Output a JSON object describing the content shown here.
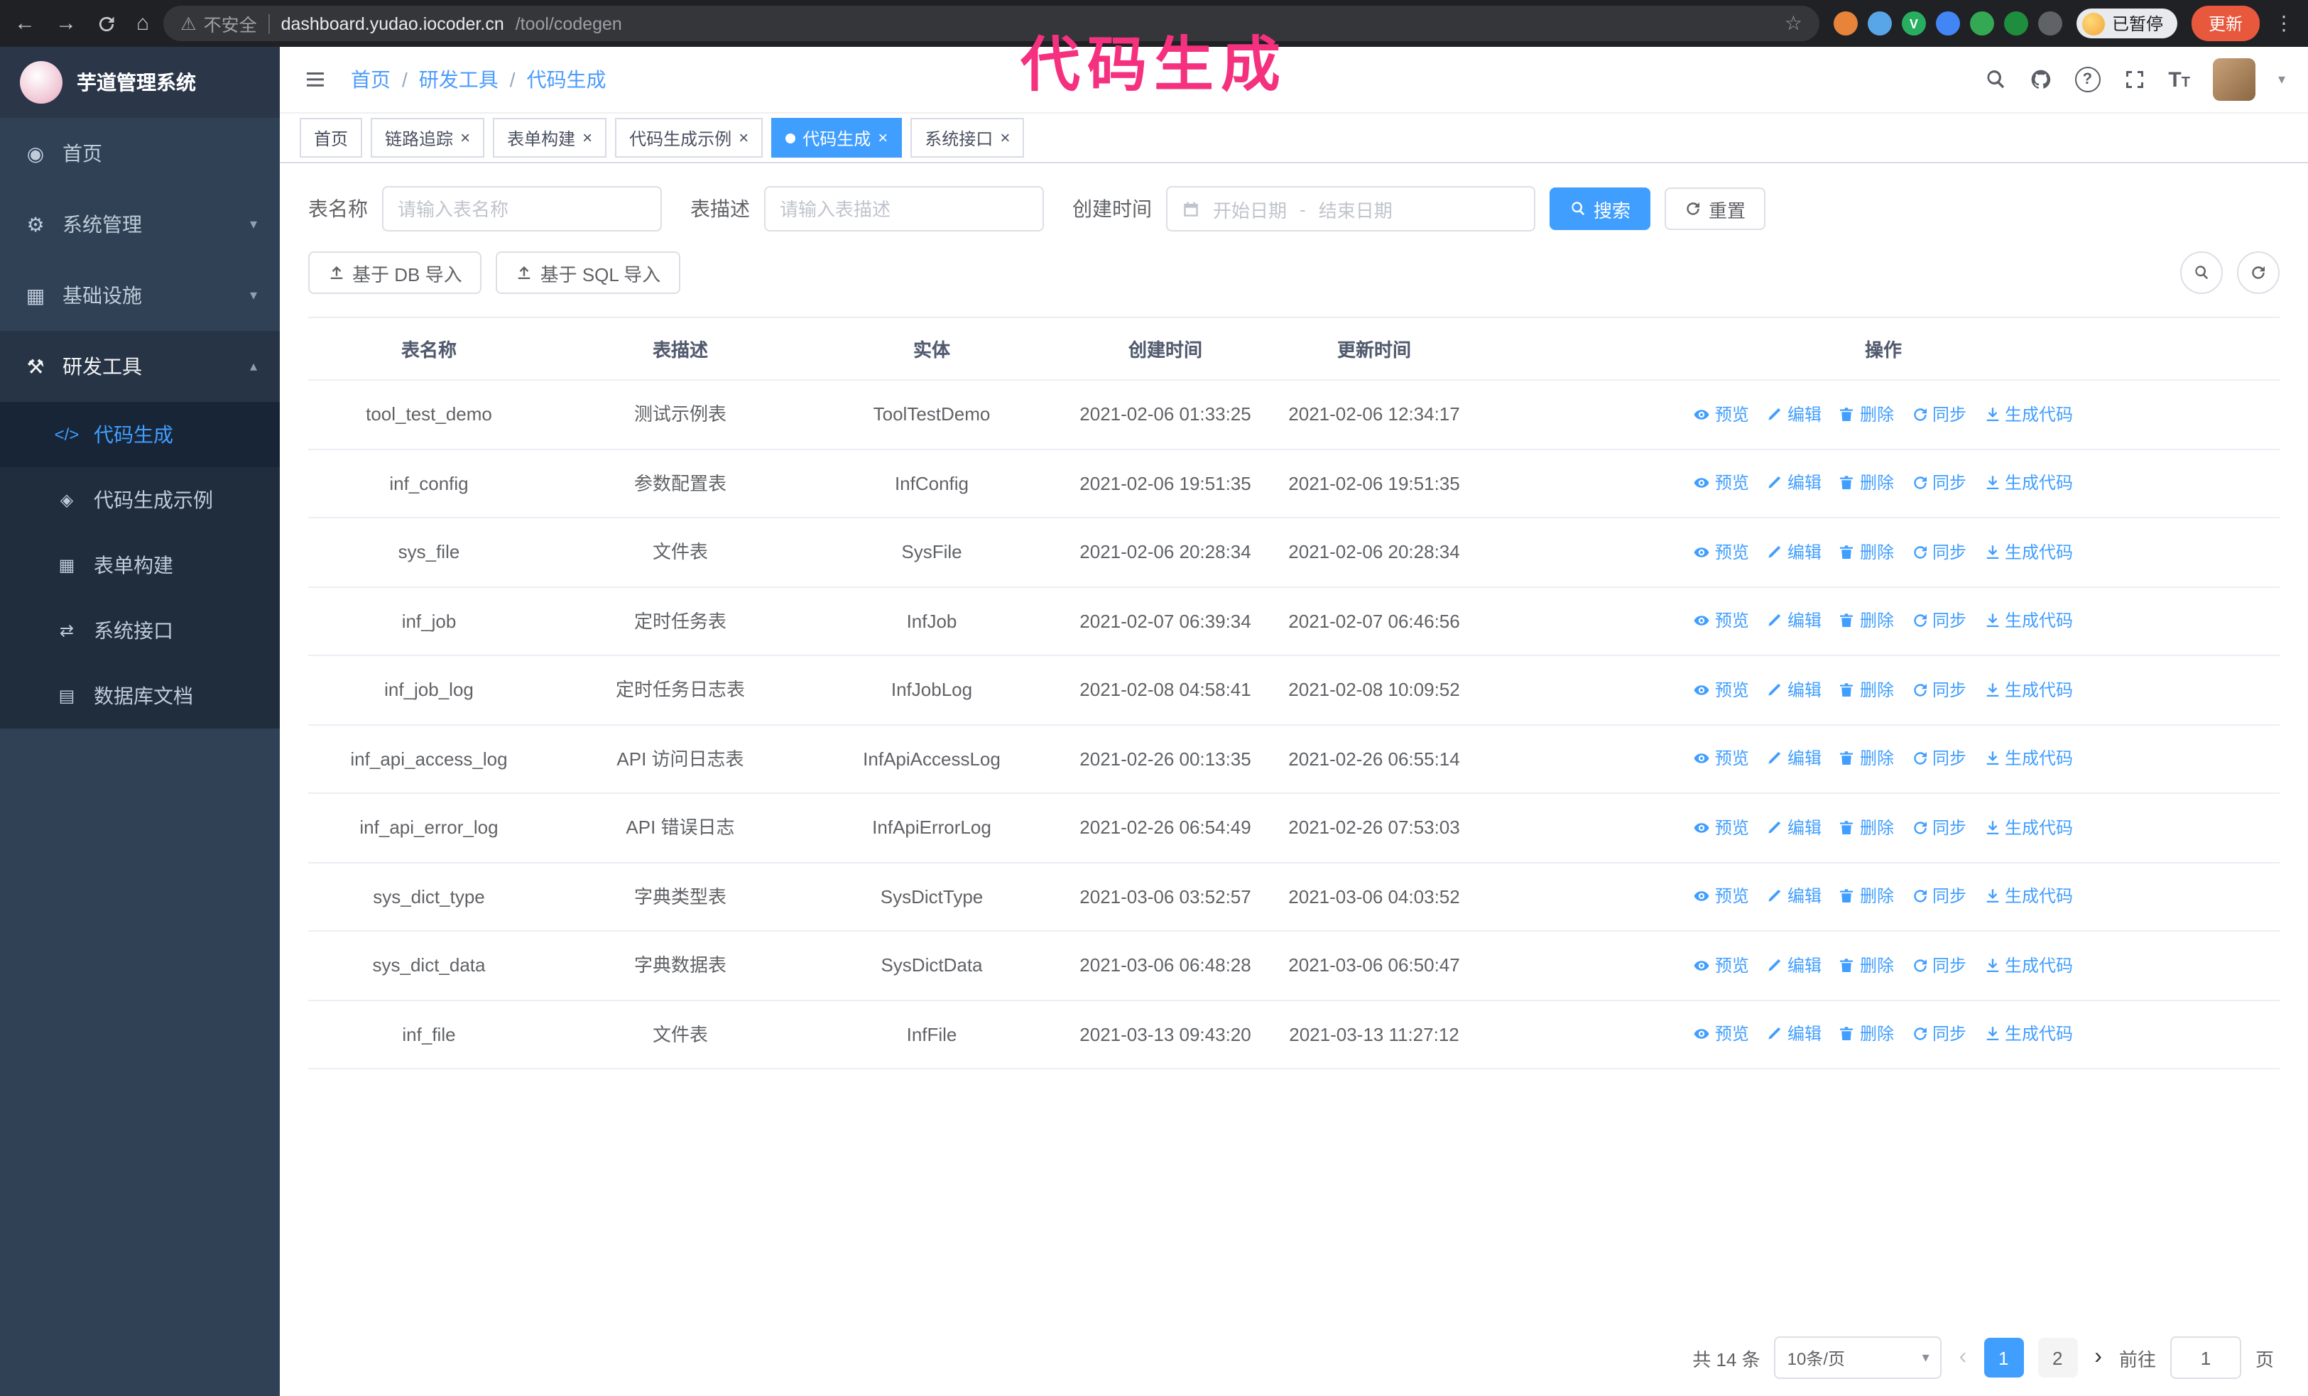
{
  "colors": {
    "accent": "#409eff",
    "sidebar_bg": "#304156",
    "submenu_bg": "#1f2d3d",
    "annotation": "#f5317f",
    "chrome_bg": "#202124",
    "update_button_bg": "#e8583d"
  },
  "annotation": {
    "text": "代码生成"
  },
  "browser": {
    "security_label": "不安全",
    "url_host": "dashboard.yudao.iocoder.cn",
    "url_path": "/tool/codegen",
    "profile_badge": "已暂停",
    "update_button": "更新",
    "extensions": [
      {
        "color": "#e8833a",
        "letter": ""
      },
      {
        "color": "#58a6e8",
        "letter": ""
      },
      {
        "color": "#27ae60",
        "letter": "V"
      },
      {
        "color": "#4285f4",
        "letter": ""
      },
      {
        "color": "#34a853",
        "letter": ""
      },
      {
        "color": "#1e8e3e",
        "letter": ""
      },
      {
        "color": "#5f6368",
        "letter": ""
      }
    ]
  },
  "icons": {
    "back": "←",
    "forward": "→",
    "home": "⌂",
    "warning": "⚠",
    "star": "☆",
    "overflow": "⋮",
    "close": "×",
    "slash": "/",
    "dash": "-",
    "question": "?",
    "fontsize": "T",
    "chevron_down": "▾",
    "chevron_up": "▴",
    "caret_down": "▾",
    "dashboard": "◉",
    "gear": "⚙",
    "infra": "▦",
    "tools": "⚒",
    "code": "</>",
    "example": "◈",
    "form": "▦",
    "api": "⇄",
    "db": "▤",
    "prev": "‹",
    "next": "›"
  },
  "sidebar": {
    "app_title": "芋道管理系统",
    "items": [
      {
        "label": "首页"
      },
      {
        "label": "系统管理",
        "expandable": true
      },
      {
        "label": "基础设施",
        "expandable": true
      },
      {
        "label": "研发工具",
        "expandable": true,
        "expanded": true
      }
    ],
    "submenu": [
      {
        "label": "代码生成",
        "active": true
      },
      {
        "label": "代码生成示例"
      },
      {
        "label": "表单构建"
      },
      {
        "label": "系统接口"
      },
      {
        "label": "数据库文档"
      }
    ]
  },
  "header": {
    "breadcrumb": [
      "首页",
      "研发工具",
      "代码生成"
    ]
  },
  "tabs": [
    {
      "label": "首页",
      "closable": false
    },
    {
      "label": "链路追踪",
      "closable": true
    },
    {
      "label": "表单构建",
      "closable": true
    },
    {
      "label": "代码生成示例",
      "closable": true
    },
    {
      "label": "代码生成",
      "closable": true,
      "active": true
    },
    {
      "label": "系统接口",
      "closable": true
    }
  ],
  "filters": {
    "table_name_label": "表名称",
    "table_name_placeholder": "请输入表名称",
    "table_desc_label": "表描述",
    "table_desc_placeholder": "请输入表描述",
    "create_time_label": "创建时间",
    "start_date_placeholder": "开始日期",
    "end_date_placeholder": "结束日期",
    "search_button": "搜索",
    "reset_button": "重置"
  },
  "toolbar": {
    "import_db_button": "基于 DB 导入",
    "import_sql_button": "基于 SQL 导入"
  },
  "table": {
    "columns": [
      "表名称",
      "表描述",
      "实体",
      "创建时间",
      "更新时间",
      "操作"
    ],
    "actions": {
      "preview": "预览",
      "edit": "编辑",
      "delete": "删除",
      "sync": "同步",
      "generate": "生成代码"
    },
    "rows": [
      {
        "name": "tool_test_demo",
        "desc": "测试示例表",
        "entity": "ToolTestDemo",
        "created": "2021-02-06 01:33:25",
        "updated": "2021-02-06 12:34:17"
      },
      {
        "name": "inf_config",
        "desc": "参数配置表",
        "entity": "InfConfig",
        "created": "2021-02-06 19:51:35",
        "updated": "2021-02-06 19:51:35"
      },
      {
        "name": "sys_file",
        "desc": "文件表",
        "entity": "SysFile",
        "created": "2021-02-06 20:28:34",
        "updated": "2021-02-06 20:28:34"
      },
      {
        "name": "inf_job",
        "desc": "定时任务表",
        "entity": "InfJob",
        "created": "2021-02-07 06:39:34",
        "updated": "2021-02-07 06:46:56"
      },
      {
        "name": "inf_job_log",
        "desc": "定时任务日志表",
        "entity": "InfJobLog",
        "created": "2021-02-08 04:58:41",
        "updated": "2021-02-08 10:09:52"
      },
      {
        "name": "inf_api_access_log",
        "desc": "API 访问日志表",
        "entity": "InfApiAccessLog",
        "created": "2021-02-26 00:13:35",
        "updated": "2021-02-26 06:55:14"
      },
      {
        "name": "inf_api_error_log",
        "desc": "API 错误日志",
        "entity": "InfApiErrorLog",
        "created": "2021-02-26 06:54:49",
        "updated": "2021-02-26 07:53:03"
      },
      {
        "name": "sys_dict_type",
        "desc": "字典类型表",
        "entity": "SysDictType",
        "created": "2021-03-06 03:52:57",
        "updated": "2021-03-06 04:03:52"
      },
      {
        "name": "sys_dict_data",
        "desc": "字典数据表",
        "entity": "SysDictData",
        "created": "2021-03-06 06:48:28",
        "updated": "2021-03-06 06:50:47"
      },
      {
        "name": "inf_file",
        "desc": "文件表",
        "entity": "InfFile",
        "created": "2021-03-13 09:43:20",
        "updated": "2021-03-13 11:27:12"
      }
    ]
  },
  "pagination": {
    "total": "共 14 条",
    "page_size": "10条/页",
    "pages": [
      "1",
      "2"
    ],
    "current_page": "1",
    "goto_label": "前往",
    "goto_value": "1",
    "goto_suffix": "页"
  }
}
